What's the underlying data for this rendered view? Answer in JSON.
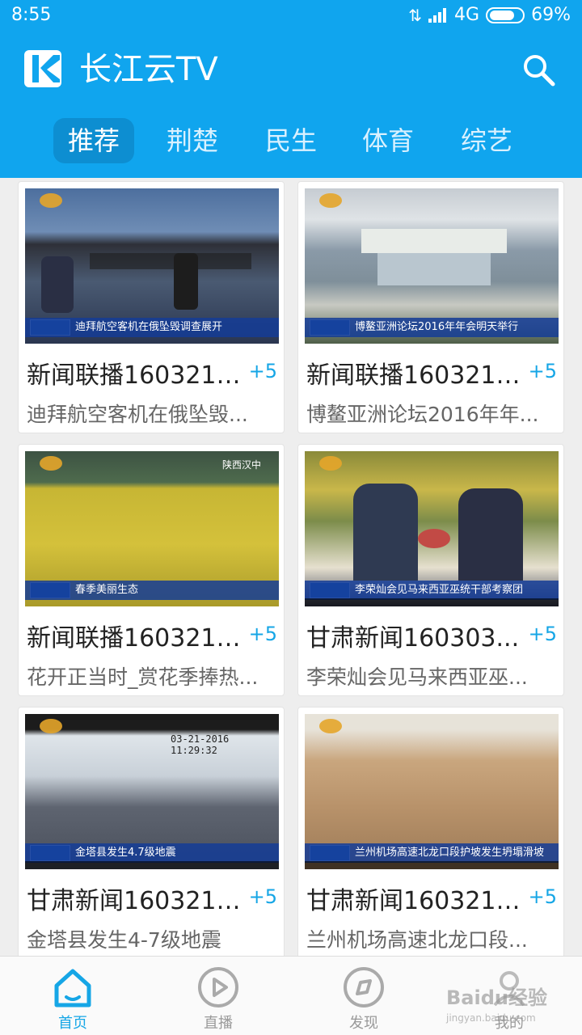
{
  "status_bar": {
    "time": "8:55",
    "network": "4G",
    "battery": "69%"
  },
  "header": {
    "title": "长江云TV"
  },
  "tabs": [
    {
      "label": "推荐",
      "active": true
    },
    {
      "label": "荆楚"
    },
    {
      "label": "民生"
    },
    {
      "label": "体育"
    },
    {
      "label": "综艺"
    }
  ],
  "cards": [
    {
      "title": "新闻联播160321_...",
      "count": "+5",
      "subtitle": "迪拜航空客机在俄坠毁...",
      "caption": "迪拜航空客机在俄坠毁调查展开"
    },
    {
      "title": "新闻联播160321_...",
      "count": "+5",
      "subtitle": "博鳌亚洲论坛2016年年...",
      "caption": "博鳌亚洲论坛2016年年会明天举行"
    },
    {
      "title": "新闻联播160321_...",
      "count": "+5",
      "subtitle": "花开正当时_赏花季捧热...",
      "caption": "春季美丽生态",
      "corner": "陕西汉中"
    },
    {
      "title": "甘肃新闻160303...",
      "count": "+5",
      "subtitle": "李荣灿会见马来西亚巫...",
      "caption": "李荣灿会见马来西亚巫统干部考察团"
    },
    {
      "title": "甘肃新闻160321_...",
      "count": "+5",
      "subtitle": "金塔县发生4-7级地震",
      "caption": "金塔县发生4.7级地震",
      "timestamp": "03-21-2016 11:29:32"
    },
    {
      "title": "甘肃新闻160321_...",
      "count": "+5",
      "subtitle": "兰州机场高速北龙口段...",
      "caption": "兰州机场高速北龙口段护坡发生坍塌滑坡"
    }
  ],
  "bottom_nav": [
    {
      "label": "首页",
      "icon": "home-icon",
      "active": true
    },
    {
      "label": "直播",
      "icon": "play-icon"
    },
    {
      "label": "发现",
      "icon": "compass-icon"
    },
    {
      "label": "我的",
      "icon": "user-icon"
    }
  ],
  "watermark": {
    "text": "Baidu经验",
    "sub": "jingyan.baidu.com"
  },
  "colors": {
    "brand": "#10a5ee",
    "accent": "#16a6e6",
    "tab_active": "#0d8ed1"
  }
}
